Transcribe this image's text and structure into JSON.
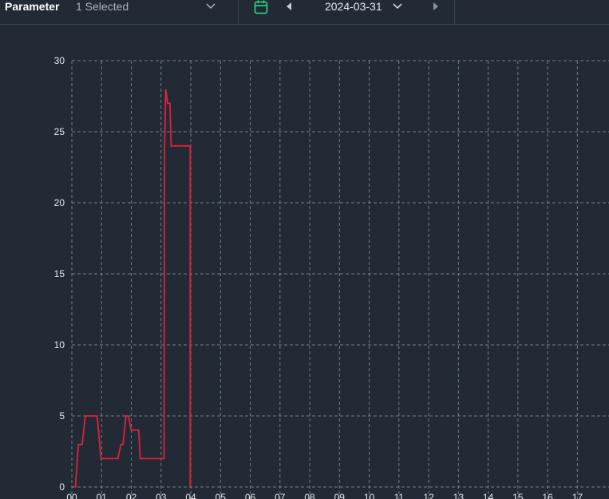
{
  "toolbar": {
    "parameter_label": "Parameter",
    "parameter_value": "1 Selected",
    "parameter_chevron_icon": "chevron-down-icon",
    "calendar_icon": "calendar-icon",
    "prev_icon": "caret-left-icon",
    "date_value": "2024-03-31",
    "date_chevron_icon": "chevron-down-icon",
    "next_icon": "caret-right-icon",
    "accent_color": "#2fd68a"
  },
  "chart_data": {
    "type": "line",
    "title": "",
    "xlabel": "",
    "ylabel": "",
    "xlim": [
      0,
      17.5
    ],
    "ylim": [
      0,
      30
    ],
    "grid": true,
    "grid_style": "dashed",
    "x_ticks": [
      "00",
      "01",
      "02",
      "03",
      "04",
      "05",
      "06",
      "07",
      "08",
      "09",
      "10",
      "11",
      "12",
      "13",
      "14",
      "15",
      "16",
      "17"
    ],
    "y_ticks": [
      0,
      5,
      10,
      15,
      20,
      25,
      30
    ],
    "series": [
      {
        "color": "#e0203f",
        "x": [
          0.05,
          0.12,
          0.22,
          0.35,
          0.45,
          0.55,
          0.85,
          0.98,
          1.05,
          1.15,
          1.55,
          1.65,
          1.72,
          1.82,
          1.9,
          2.0,
          2.08,
          2.15,
          2.25,
          2.3,
          3.1,
          3.12,
          3.12,
          3.16,
          3.22,
          3.27,
          3.3,
          3.34,
          3.35,
          3.45,
          3.5,
          3.6,
          3.87,
          3.98,
          3.98,
          3.98,
          3.98
        ],
        "y": [
          0,
          0,
          3,
          3,
          5,
          5,
          5,
          2,
          2,
          2,
          2,
          3,
          3,
          5,
          5,
          4,
          4,
          4,
          4,
          2,
          2,
          24,
          24,
          28,
          27,
          27,
          27,
          24,
          24,
          24,
          24,
          24,
          24,
          24,
          24,
          0,
          0
        ]
      }
    ]
  }
}
